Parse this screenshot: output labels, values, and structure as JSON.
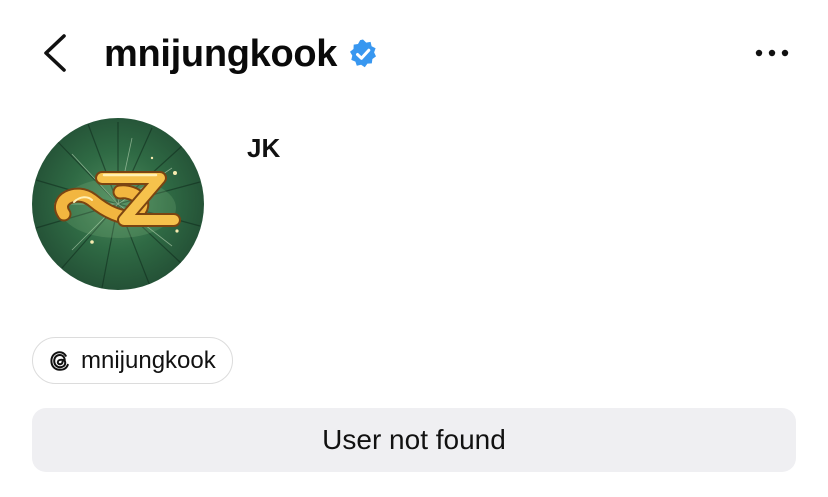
{
  "header": {
    "username": "mnijungkook",
    "verified": true,
    "back_icon": "chevron-left-icon",
    "more_icon": "more-horizontal-icon",
    "verified_color": "#3897f0"
  },
  "profile": {
    "display_name": "JK",
    "avatar_description": "avatar-image"
  },
  "threads_link": {
    "icon": "threads-icon",
    "label": "mnijungkook"
  },
  "status": {
    "label": "User not found"
  }
}
